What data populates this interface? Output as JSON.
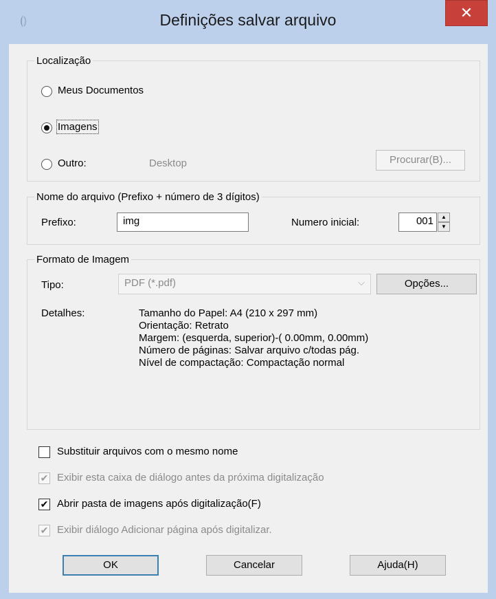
{
  "window": {
    "title": "Definições salvar arquivo",
    "close_glyph": "✕",
    "accent": "#c7403a"
  },
  "location": {
    "group_label": "Localização",
    "options": [
      {
        "label": "Meus Documentos",
        "selected": false
      },
      {
        "label": "Imagens",
        "selected": true
      },
      {
        "label": "Outro:",
        "selected": false
      }
    ],
    "other_path": "Desktop",
    "browse_label": "Procurar(B)..."
  },
  "filename": {
    "group_label": "Nome do arquivo (Prefixo + número de 3 dígitos)",
    "prefix_label": "Prefixo:",
    "prefix_value": "img",
    "start_label": "Numero inicial:",
    "start_value": "001"
  },
  "format": {
    "group_label": "Formato de Imagem",
    "type_label": "Tipo:",
    "type_value": "PDF (*.pdf)",
    "options_label": "Opções...",
    "details_label": "Detalhes:",
    "details": [
      "Tamanho do Papel: A4 (210 x 297 mm)",
      "Orientação: Retrato",
      "Margem: (esquerda, superior)-( 0.00mm, 0.00mm)",
      "Número de páginas: Salvar arquivo c/todas pág.",
      "Nível de compactação: Compactação normal"
    ]
  },
  "checkboxes": [
    {
      "label": "Substituir arquivos com o mesmo nome",
      "checked": false,
      "enabled": true
    },
    {
      "label": "Exibir esta caixa de diálogo antes da próxima digitalização",
      "checked": true,
      "enabled": false
    },
    {
      "label": "Abrir pasta de imagens após digitalização(F)",
      "checked": true,
      "enabled": true
    },
    {
      "label": "Exibir diálogo Adicionar página após digitalizar.",
      "checked": true,
      "enabled": false
    }
  ],
  "buttons": {
    "ok": "OK",
    "cancel": "Cancelar",
    "help": "Ajuda(H)"
  }
}
